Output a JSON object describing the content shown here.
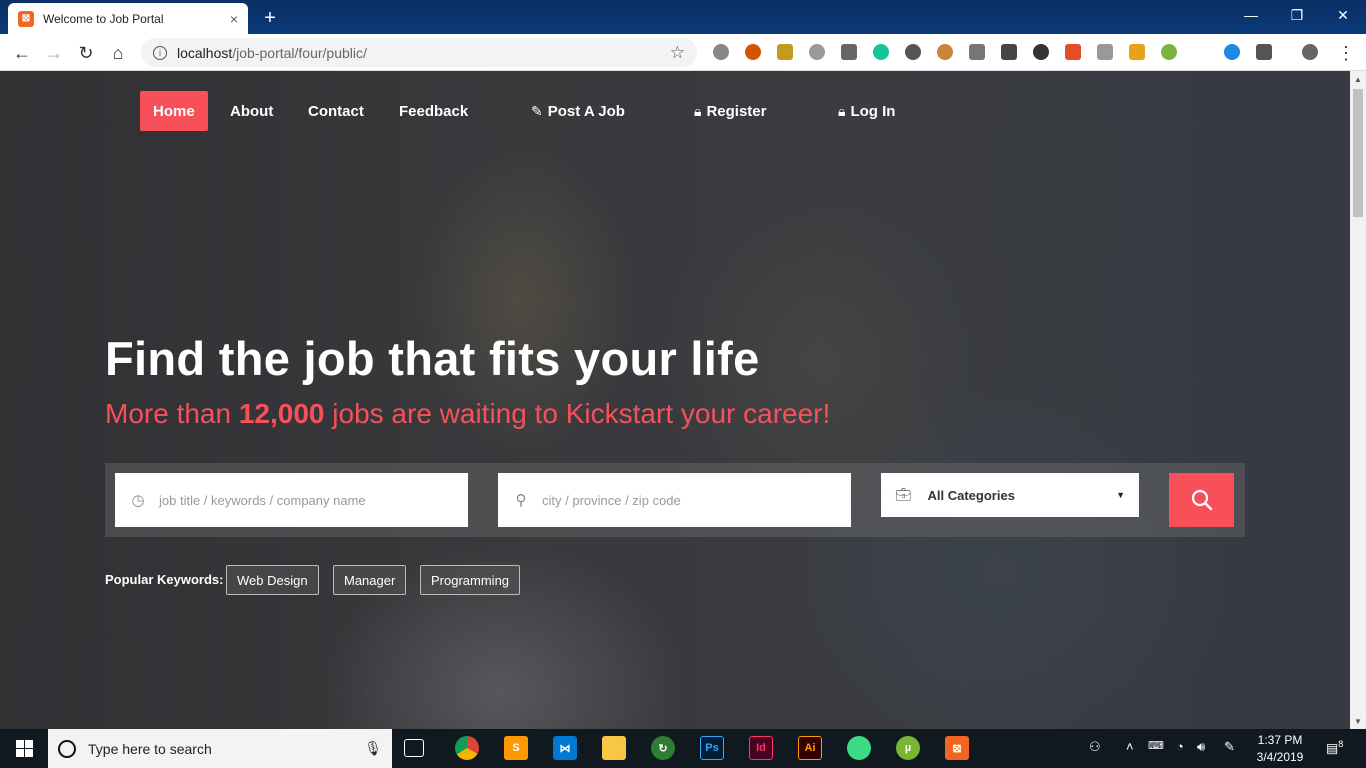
{
  "browser": {
    "tab_title": "Welcome to Job Portal",
    "tab_close": "×",
    "new_tab": "+",
    "url_host": "localhost",
    "url_path": "/job-portal/four/public/",
    "win_minimize": "—",
    "win_restore": "❐",
    "win_close": "✕"
  },
  "nav": {
    "home": "Home",
    "about": "About",
    "contact": "Contact",
    "feedback": "Feedback",
    "post_job": "Post A Job",
    "register": "Register",
    "login": "Log In"
  },
  "hero": {
    "title": "Find the job that fits your life",
    "sub_pre": "More than ",
    "sub_count": "12,000",
    "sub_post": " jobs are waiting to Kickstart your career!"
  },
  "search": {
    "keyword_placeholder": "job title / keywords / company name",
    "location_placeholder": "city / province / zip code",
    "category_selected": "All Categories"
  },
  "keywords": {
    "label": "Popular Keywords:",
    "items": [
      "Web Design",
      "Manager",
      "Programming"
    ]
  },
  "taskbar": {
    "search_placeholder": "Type here to search",
    "time": "1:37 PM",
    "date": "3/4/2019",
    "notifications": "8"
  },
  "colors": {
    "accent": "#f7505a",
    "titlebar": "#0b2f63",
    "taskbar": "#101820"
  }
}
